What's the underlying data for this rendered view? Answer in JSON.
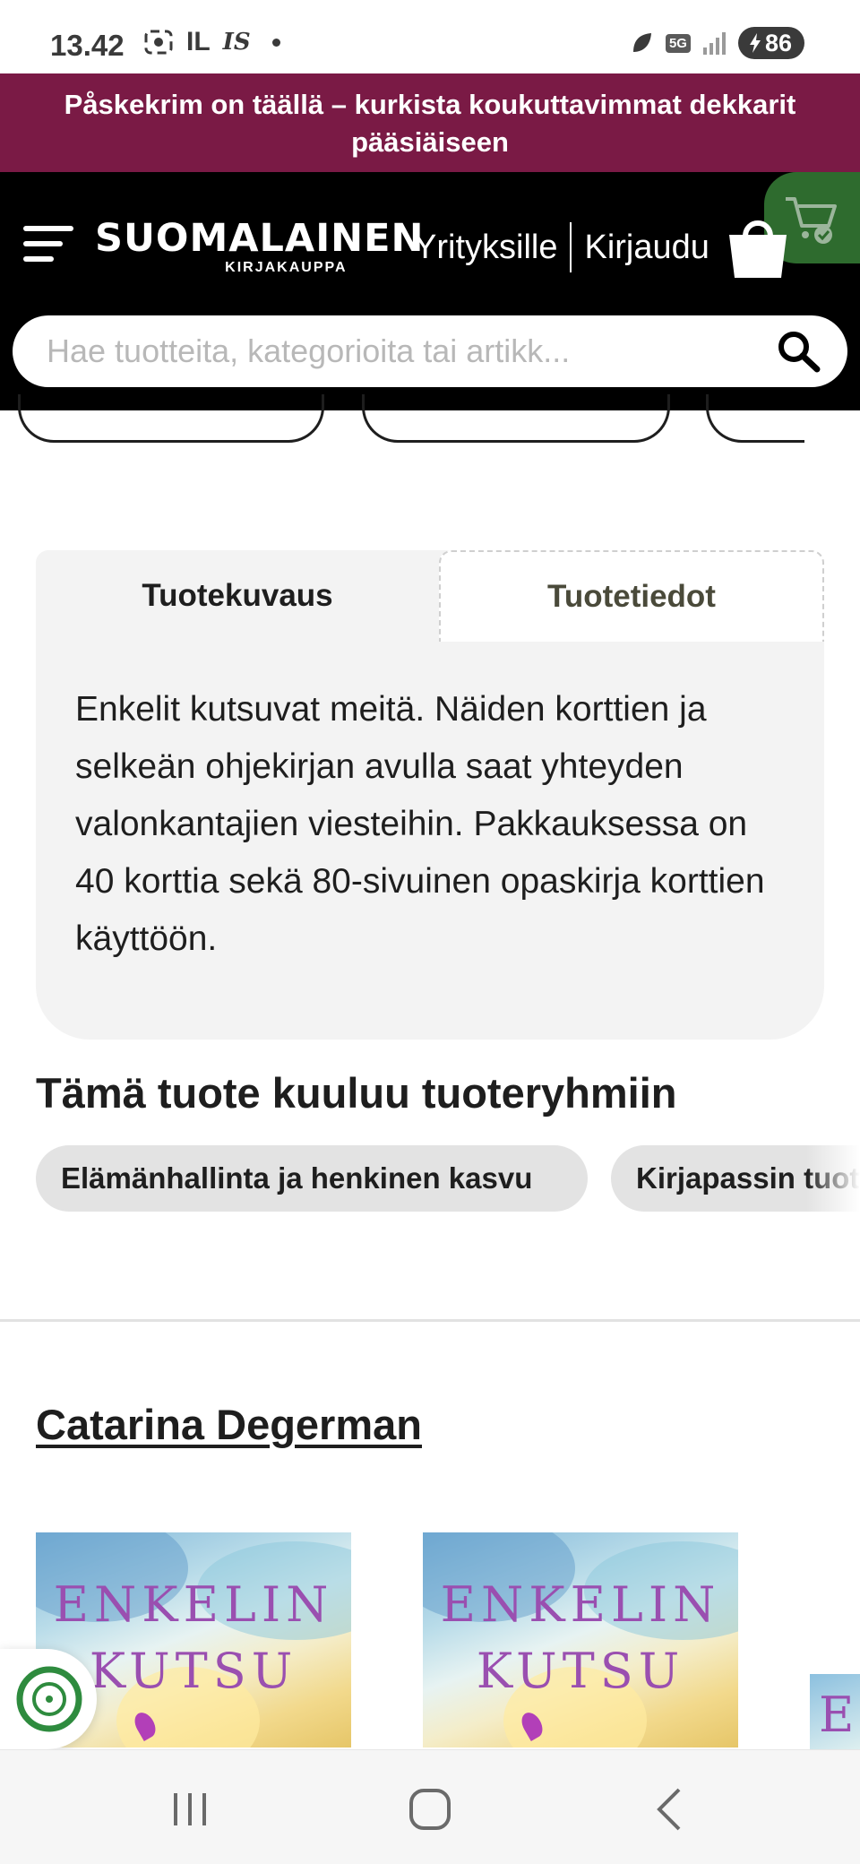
{
  "status_bar": {
    "time": "13.42",
    "left_icons": [
      "screenshot-icon",
      "il-app-icon",
      "is-app-icon"
    ],
    "left_texts": [
      "IL",
      "IS"
    ],
    "network": "5G",
    "battery": "86"
  },
  "promo_banner": {
    "text": "Påskekrim on täällä – kurkista koukuttavimmat dekkarit pääsiäiseen",
    "background": "#7a1a45"
  },
  "header": {
    "logo_main": "SUOMALAINEN",
    "logo_sub": "KIRJAKAUPPA",
    "link_business": "Yrityksille",
    "link_login": "Kirjaudu",
    "cart_accent": "#2e6b2e"
  },
  "search": {
    "placeholder": "Hae tuotteita, kategorioita tai artikk..."
  },
  "tabs": {
    "description_label": "Tuotekuvaus",
    "details_label": "Tuotetiedot"
  },
  "description": "Enkelit kutsuvat meitä. Näiden korttien ja selkeän ohjekirjan avulla saat yhteyden valonkantajien viesteihin. Pakkauksessa on 40 korttia sekä 80-sivuinen opaskirja korttien käyttöön.",
  "product_groups": {
    "heading": "Tämä tuote kuuluu tuoteryhmiin",
    "chips": [
      "Elämänhallinta ja henkinen kasvu",
      "Kirjapassin tuotteet"
    ]
  },
  "author": {
    "name": "Catarina Degerman"
  },
  "products": [
    {
      "cover_line1": "ENKELIN",
      "cover_line2": "KUTSU"
    },
    {
      "cover_line1": "ENKELIN",
      "cover_line2": "KUTSU"
    }
  ],
  "product_peek_letter": "E"
}
